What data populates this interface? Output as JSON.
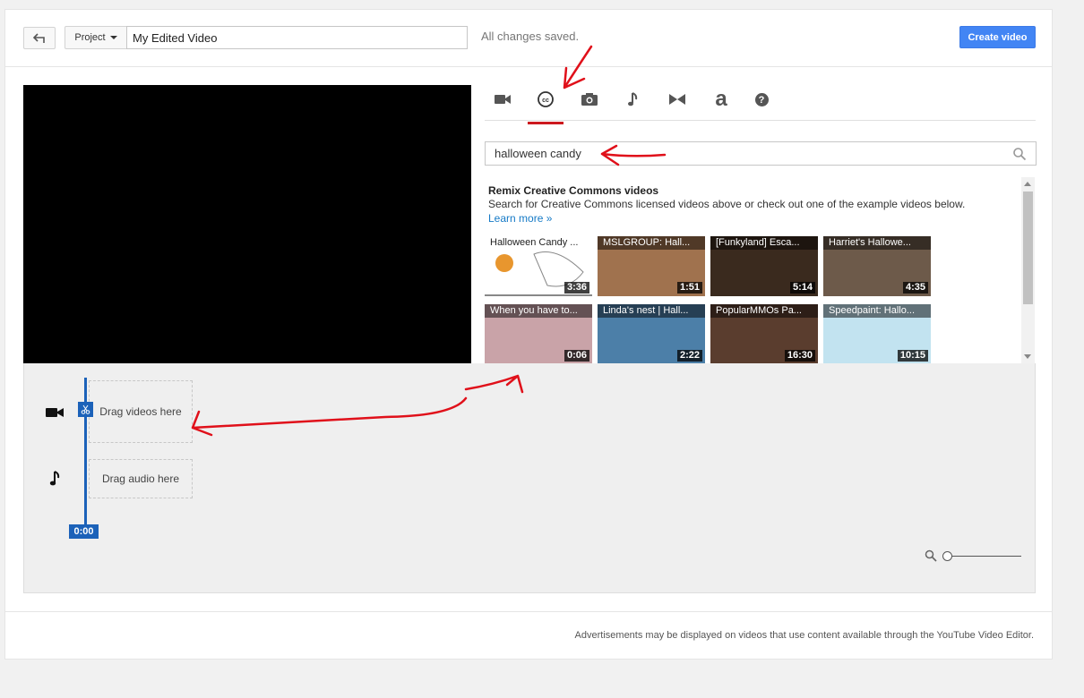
{
  "header": {
    "back_icon": "back-arrow-icon",
    "project_label": "Project",
    "title_value": "My Edited Video",
    "saved_status": "All changes saved.",
    "create_label": "Create video"
  },
  "tabs": [
    {
      "icon": "video-camera-icon"
    },
    {
      "icon": "creative-commons-icon",
      "active": true
    },
    {
      "icon": "photo-camera-icon"
    },
    {
      "icon": "music-note-icon"
    },
    {
      "icon": "transitions-icon"
    },
    {
      "icon": "text-icon",
      "glyph": "a"
    },
    {
      "icon": "help-icon",
      "glyph": "?"
    }
  ],
  "search": {
    "value": "halloween candy"
  },
  "cc": {
    "title": "Remix Creative Commons videos",
    "description": "Search for Creative Commons licensed videos above or check out one of the example videos below.",
    "learn_more": "Learn more »"
  },
  "videos": [
    {
      "title": "Halloween Candy ...",
      "duration": "3:36",
      "bg": "#ffffff",
      "dark": true
    },
    {
      "title": "MSLGROUP: Hall...",
      "duration": "1:51",
      "bg": "#a0724e"
    },
    {
      "title": "[Funkyland] Esca...",
      "duration": "5:14",
      "bg": "#3a2a1e"
    },
    {
      "title": "Harriet's Hallowe...",
      "duration": "4:35",
      "bg": "#6d5a4a"
    },
    {
      "title": "When you have to...",
      "duration": "0:06",
      "bg": "#c9a3a8"
    },
    {
      "title": "Linda's nest | Hall...",
      "duration": "2:22",
      "bg": "#4c7fa8"
    },
    {
      "title": "PopularMMOs Pa...",
      "duration": "16:30",
      "bg": "#5a3d2e"
    },
    {
      "title": "Speedpaint: Hallo...",
      "duration": "10:15",
      "bg": "#c2e3f0"
    }
  ],
  "timeline": {
    "video_drop": "Drag videos here",
    "audio_drop": "Drag audio here",
    "time": "0:00",
    "zoom_level": 0
  },
  "footer": {
    "note": "Advertisements may be displayed on videos that use content available through the YouTube Video Editor."
  },
  "colors": {
    "accent": "#4285f4",
    "active_tab": "#cc181e",
    "playhead": "#1c62b9",
    "link": "#167ac6",
    "annotation": "#e0101a"
  }
}
